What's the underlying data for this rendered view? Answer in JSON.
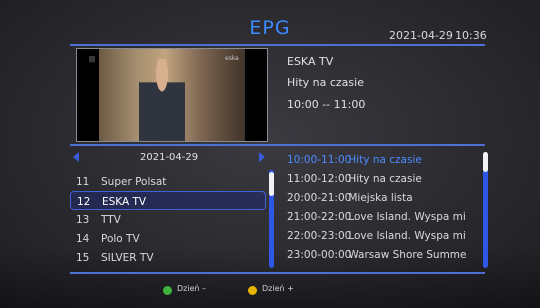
{
  "header": {
    "title": "EPG",
    "date": "2021-04-29",
    "time": "10:36"
  },
  "preview": {
    "logo_left": "|||",
    "logo_right": "eska"
  },
  "info": {
    "channel_name": "ESKA TV",
    "event_title": "Hity na czasie",
    "event_time": "10:00  --  11:00"
  },
  "channel_list": {
    "date": "2021-04-29",
    "selected_index": 1,
    "items": [
      {
        "num": "11",
        "name": "Super Polsat"
      },
      {
        "num": "12",
        "name": "ESKA TV"
      },
      {
        "num": "13",
        "name": "TTV"
      },
      {
        "num": "14",
        "name": "Polo TV"
      },
      {
        "num": "15",
        "name": "SILVER TV"
      }
    ]
  },
  "programs": [
    {
      "time": "10:00-11:00",
      "title": "Hity na czasie",
      "active": true
    },
    {
      "time": "11:00-12:00",
      "title": "Hity na czasie",
      "active": false
    },
    {
      "time": "20:00-21:00",
      "title": "Miejska lista",
      "active": false
    },
    {
      "time": "21:00-22:00",
      "title": "Love Island. Wyspa mi",
      "active": false
    },
    {
      "time": "22:00-23:00",
      "title": "Love Island. Wyspa mi",
      "active": false
    },
    {
      "time": "23:00-00:00",
      "title": "Warsaw Shore Summe",
      "active": false
    }
  ],
  "footer": {
    "green_label": "Dzień –",
    "yellow_label": "Dzień +",
    "green_color": "#3fb43f",
    "yellow_color": "#e8b400"
  },
  "colors": {
    "accent": "#3c8bff",
    "selection_border": "#3e63d6",
    "scrollbar": "#2f57e6"
  }
}
